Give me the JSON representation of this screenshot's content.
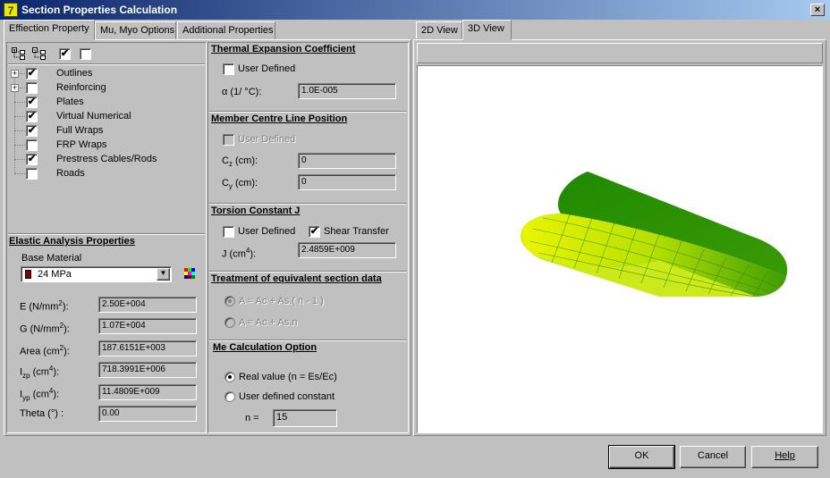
{
  "window": {
    "title": "Section Properties Calculation",
    "close": "×",
    "app_icon_glyph": "7"
  },
  "tabs": [
    {
      "label": "Effiection Property"
    },
    {
      "label": "Mu, Myo Options"
    },
    {
      "label": "Additional Properties"
    }
  ],
  "view_tabs": [
    {
      "label": "2D View"
    },
    {
      "label": "3D View"
    }
  ],
  "toolbar": {
    "expand_icon": "expand-tree-icon",
    "collapse_icon": "collapse-tree-icon",
    "check_all": "✔",
    "uncheck_all": ""
  },
  "tree": {
    "items": [
      {
        "label": "Outlines",
        "checked": true,
        "expandable": true
      },
      {
        "label": "Reinforcing",
        "checked": false,
        "expandable": true
      },
      {
        "label": "Plates",
        "checked": true,
        "expandable": false
      },
      {
        "label": "Virtual Numerical",
        "checked": true,
        "expandable": false
      },
      {
        "label": "Full Wraps",
        "checked": true,
        "expandable": false
      },
      {
        "label": "FRP Wraps",
        "checked": false,
        "expandable": false
      },
      {
        "label": "Prestress Cables/Rods",
        "checked": true,
        "expandable": false
      },
      {
        "label": "Roads",
        "checked": false,
        "expandable": false
      }
    ]
  },
  "elastic": {
    "title": "Elastic Analysis Properties",
    "base_material_label": "Base Material",
    "base_material_value": "24 MPa",
    "material_color": "#800000",
    "rows": [
      {
        "label_main": "E (N/mm",
        "label_sup": "2",
        "label_end": "):",
        "value": "2.50E+004"
      },
      {
        "label_main": "G (N/mm",
        "label_sup": "2",
        "label_end": "):",
        "value": "1.07E+004"
      },
      {
        "label_main": "Area (cm",
        "label_sup": "2",
        "label_end": "):",
        "value": "187.6151E+003"
      },
      {
        "label_main": "I",
        "label_sub": "zp",
        "label_mid": " (cm",
        "label_sup": "4",
        "label_end": "):",
        "value": "718.3991E+006"
      },
      {
        "label_main": "I",
        "label_sub": "yp",
        "label_mid": " (cm",
        "label_sup": "4",
        "label_end": "):",
        "value": "11.4809E+009"
      },
      {
        "label_main": "Theta (°) :",
        "value": "0.00"
      }
    ]
  },
  "thermal": {
    "title": "Thermal Expansion Coefficient",
    "user_defined": "User Defined",
    "alpha_label": "α (1/ °C):",
    "alpha_value": "1.0E-005"
  },
  "member": {
    "title": "Member Centre Line Position",
    "user_defined": "User Defined",
    "cz_label_main": "C",
    "cz_sub": "z",
    "cz_label_end": " (cm):",
    "cz_value": "0",
    "cy_label_main": "C",
    "cy_sub": "y",
    "cy_label_end": " (cm):",
    "cy_value": "0"
  },
  "torsion": {
    "title": "Torsion Constant J",
    "user_defined": "User Defined",
    "shear_transfer": "Shear Transfer",
    "j_label_main": "J (cm",
    "j_sup": "4",
    "j_label_end": "):",
    "j_value": "2.4859E+009"
  },
  "equiv": {
    "title": "Treatment of equivalent section data",
    "opt1": "A = Ac + As.( n - 1 )",
    "opt2": "A = Ac + As.n"
  },
  "me_calc": {
    "title": "Me Calculation Option",
    "opt1": "Real value (n = Es/Ec)",
    "opt2": "User defined constant",
    "n_label": "n =",
    "n_value": "15"
  },
  "buttons": {
    "ok": "OK",
    "cancel": "Cancel",
    "help": "Help"
  },
  "colors": {
    "shape_dark": "#2a8c00",
    "shape_light": "#e8f500",
    "title_bar": "#0a246a"
  }
}
